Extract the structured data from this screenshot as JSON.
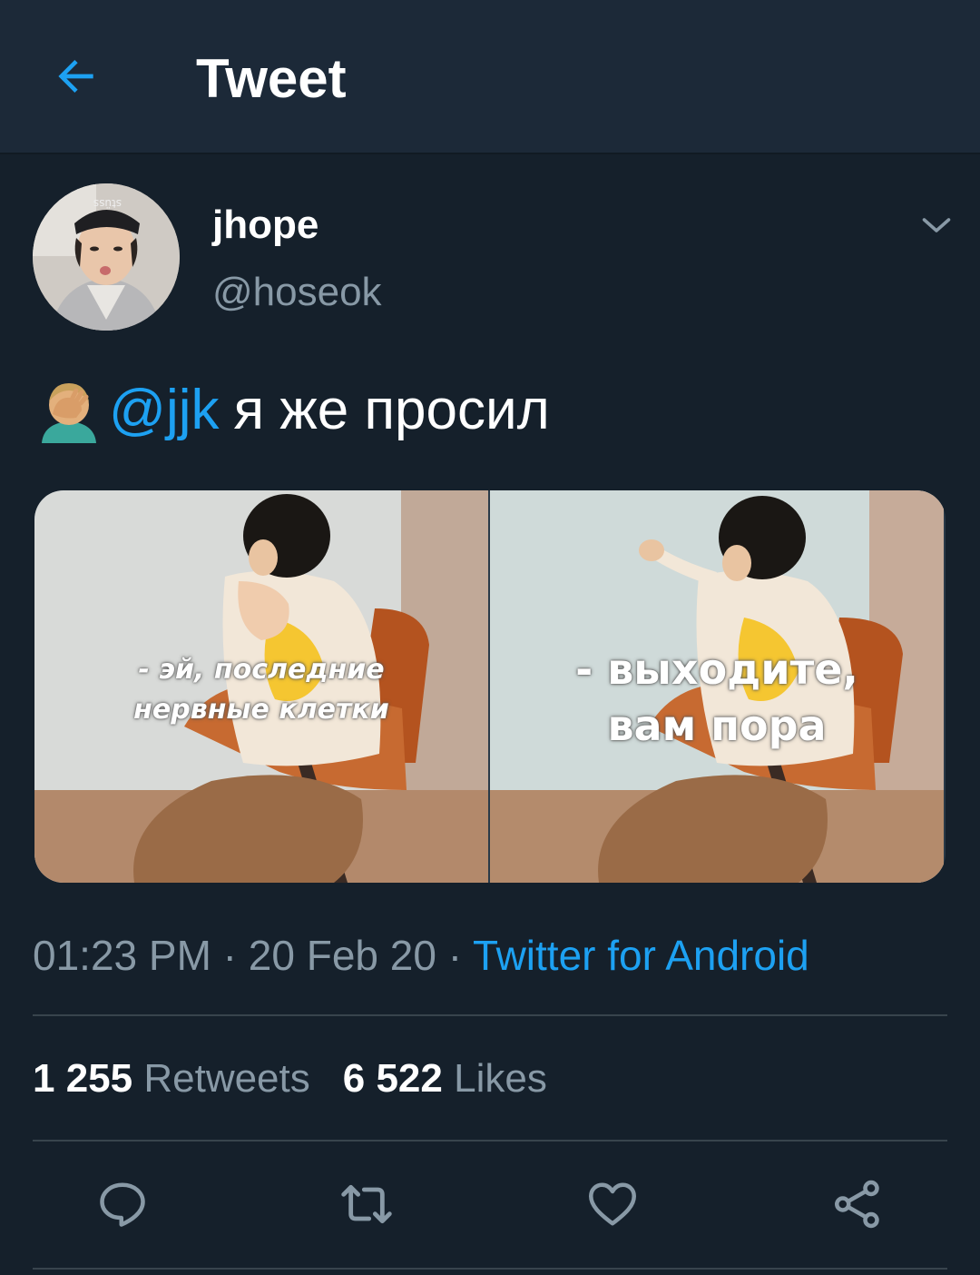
{
  "header": {
    "back_icon": "arrow-left-icon",
    "title": "Tweet"
  },
  "author": {
    "display_name": "jhope",
    "handle": "@hoseok",
    "menu_icon": "chevron-down-icon"
  },
  "tweet": {
    "emoji_icon": "face-palm-emoji",
    "mention": "@jjk",
    "text": "я же просил"
  },
  "media": {
    "left_caption_line1": "- эй, последние",
    "left_caption_line2": "нервные клетки",
    "right_caption_line1": "- выходите,",
    "right_caption_line2": "вам пора"
  },
  "meta": {
    "time": "01:23 PM",
    "separator": " · ",
    "date": "20 Feb 20",
    "source": "Twitter for Android"
  },
  "stats": {
    "retweets_count": "1 255",
    "retweets_label": "Retweets",
    "likes_count": "6 522",
    "likes_label": "Likes"
  },
  "actions": [
    "reply-icon",
    "retweet-icon",
    "like-icon",
    "share-icon"
  ],
  "colors": {
    "background": "#15202b",
    "header": "#1c2938",
    "accent": "#1da1f2",
    "secondary_text": "#8899a6",
    "divider": "#38444d"
  }
}
